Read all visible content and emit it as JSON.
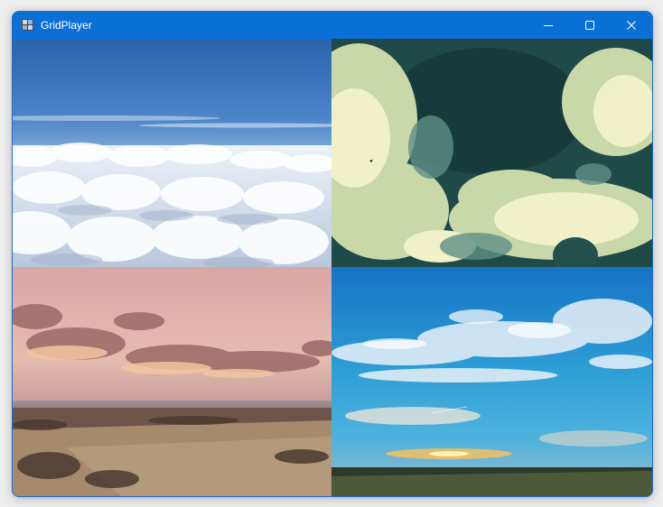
{
  "window": {
    "title": "GridPlayer",
    "accent_color": "#0b70d6",
    "controls": [
      "minimize-icon",
      "maximize-icon",
      "close-icon"
    ]
  },
  "grid": {
    "rows": 2,
    "columns": 2,
    "cells": [
      {
        "scene": "clouds-above-blue-sky"
      },
      {
        "scene": "dark-teal-cloudy-sky"
      },
      {
        "scene": "pink-sunset-over-fields"
      },
      {
        "scene": "blue-sky-altocumulus-sunset"
      }
    ]
  }
}
